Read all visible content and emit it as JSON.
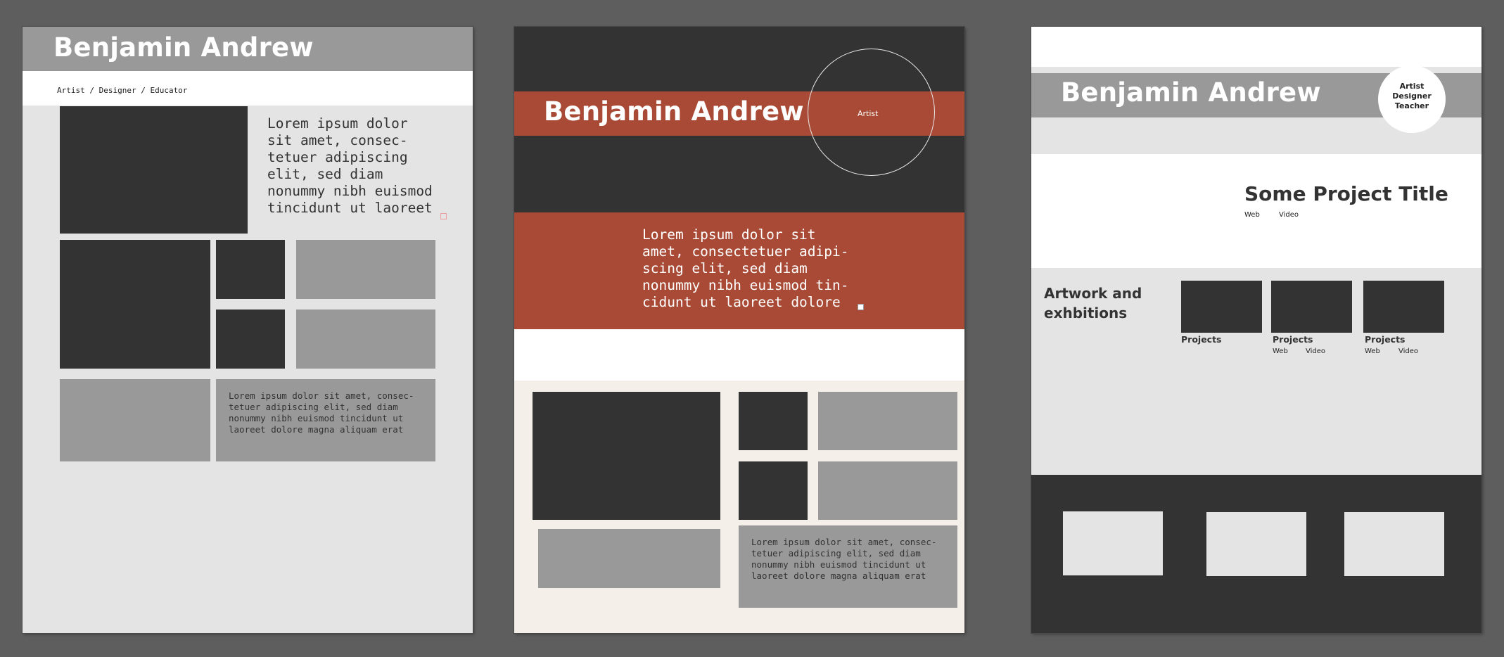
{
  "page1": {
    "name": "Benjamin Andrew",
    "roles": "Artist / Designer / Educator",
    "intro_lorem": "Lorem ipsum dolor\nsit amet, consec-\ntetuer adipiscing\nelit, sed diam\nnonummy nibh euismod\ntincidunt ut laoreet",
    "caption_lorem": "Lorem ipsum dolor sit amet, consec-\ntetuer adipiscing elit, sed diam\nnonummy nibh euismod tincidunt ut\nlaoreet dolore magna aliquam erat"
  },
  "page2": {
    "name": "Benjamin Andrew",
    "role": "Artist",
    "intro_lorem": "Lorem ipsum dolor sit\namet, consectetuer adipi-\nscing elit, sed diam\nnonummy nibh euismod tin-\ncidunt ut laoreet dolore",
    "caption_lorem": "Lorem ipsum dolor sit amet, consec-\ntetuer adipiscing elit, sed diam\nnonummy nibh euismod tincidunt ut\nlaoreet dolore magna aliquam erat"
  },
  "page3": {
    "name": "Benjamin Andrew",
    "badge": [
      "Artist",
      "Designer",
      "Teacher"
    ],
    "project_title": "Some Project Title",
    "project_tags": [
      "Web",
      "Video"
    ],
    "section_heading": "Artwork and\nexhbitions",
    "projects": [
      {
        "label": "Projects",
        "tags": []
      },
      {
        "label": "Projects",
        "tags": [
          "Web",
          "Video"
        ]
      },
      {
        "label": "Projects",
        "tags": [
          "Web",
          "Video"
        ]
      }
    ]
  },
  "colors": {
    "canvas": "#5e5e5e",
    "dark": "#333333",
    "mid_gray": "#999999",
    "light_gray": "#e4e4e4",
    "rust": "#a84a35",
    "cream": "#f4efe8"
  }
}
